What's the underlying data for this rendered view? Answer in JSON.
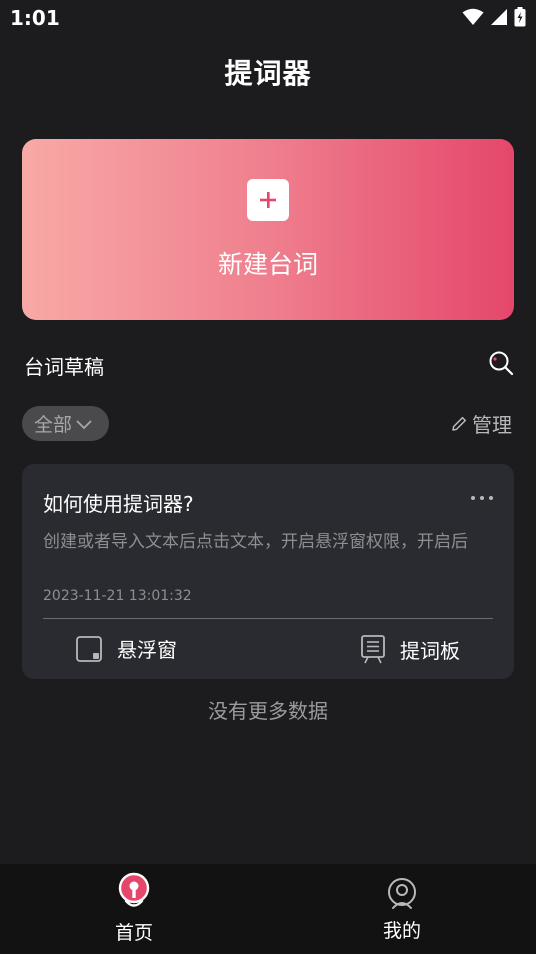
{
  "status_bar": {
    "time": "1:01"
  },
  "header": {
    "title": "提词器"
  },
  "new_card": {
    "label": "新建台词"
  },
  "drafts_section": {
    "title": "台词草稿"
  },
  "filter": {
    "selected": "全部",
    "manage_label": "管理"
  },
  "drafts": [
    {
      "title": "如何使用提词器?",
      "preview": "创建或者导入文本后点击文本，开启悬浮窗权限，开启后",
      "time": "2023-11-21 13:01:32",
      "float_label": "悬浮窗",
      "board_label": "提词板"
    }
  ],
  "list_end": {
    "text": "没有更多数据"
  },
  "bottom_nav": {
    "items": [
      {
        "label": "首页"
      },
      {
        "label": "我的"
      }
    ]
  },
  "colors": {
    "accent": "#e5476b",
    "gradient_start": "#f8a9a6",
    "background": "#1c1c1e",
    "card": "#2a2b30"
  }
}
